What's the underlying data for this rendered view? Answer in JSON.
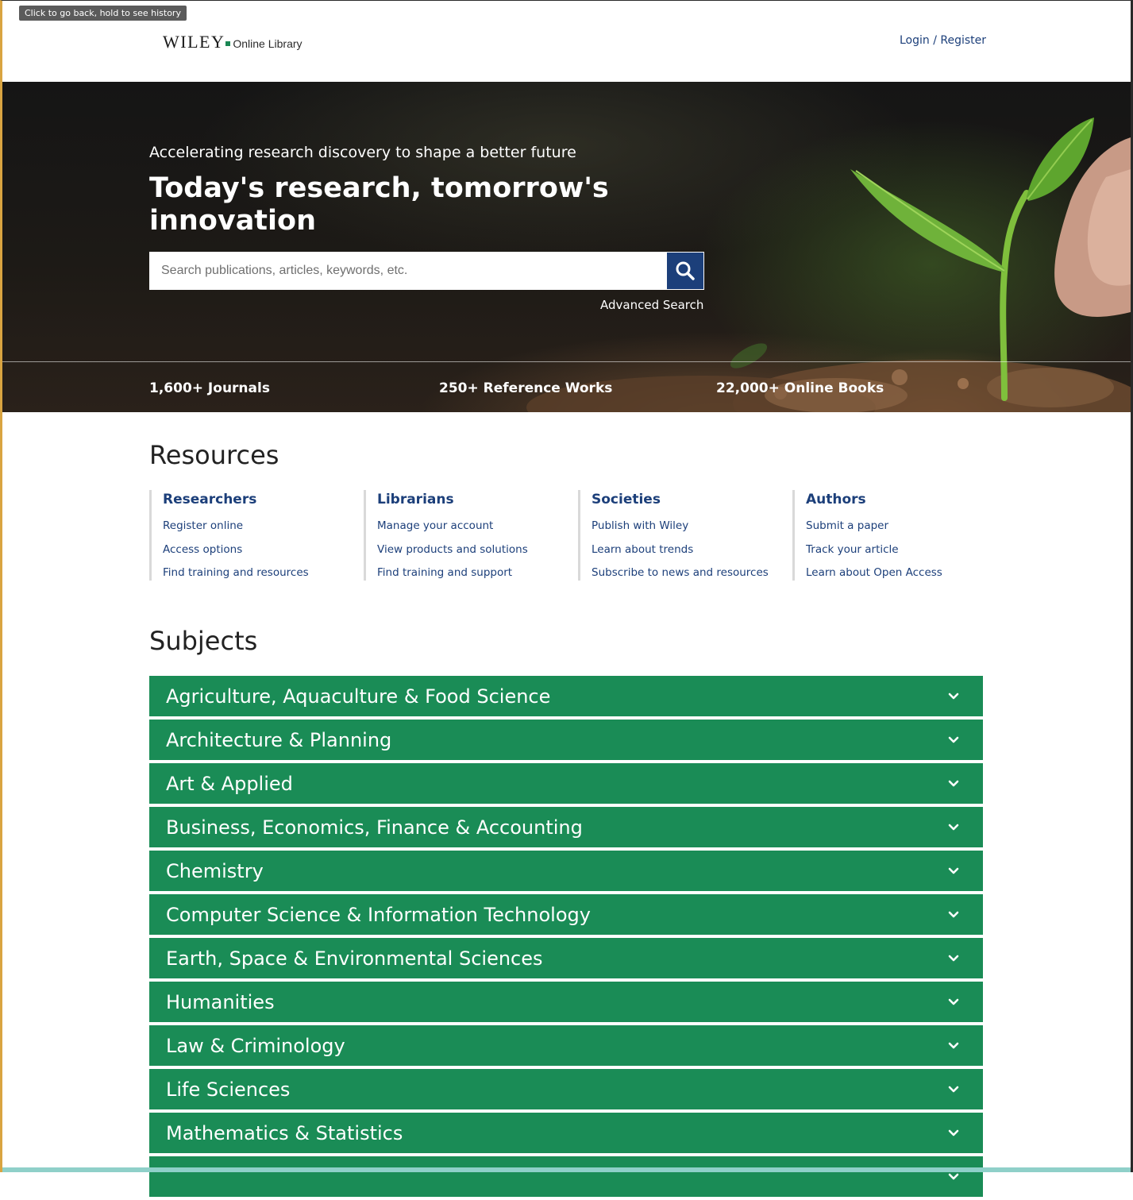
{
  "tooltip": "Click to go back, hold to see history",
  "header": {
    "logo_wiley": "WILEY",
    "logo_online_library": "Online Library",
    "login_register": "Login / Register"
  },
  "hero": {
    "tagline": "Accelerating research discovery to shape a better future",
    "title": "Today's research, tomorrow's innovation",
    "search_placeholder": "Search publications, articles, keywords, etc.",
    "search_value": "",
    "search_icon": "search-icon",
    "advanced_search": "Advanced Search",
    "stats": [
      "1,600+ Journals",
      "250+ Reference Works",
      "22,000+ Online Books"
    ]
  },
  "resources": {
    "title": "Resources",
    "columns": [
      {
        "heading": "Researchers",
        "links": [
          "Register online",
          "Access options",
          "Find training and resources"
        ]
      },
      {
        "heading": "Librarians",
        "links": [
          "Manage your account",
          "View products and solutions",
          "Find training and support"
        ]
      },
      {
        "heading": "Societies",
        "links": [
          "Publish with Wiley",
          "Learn about trends",
          "Subscribe to news and resources"
        ]
      },
      {
        "heading": "Authors",
        "links": [
          "Submit a paper",
          "Track your article",
          "Learn about Open Access"
        ]
      }
    ]
  },
  "subjects": {
    "title": "Subjects",
    "expand_icon": "chevron-down-icon",
    "items": [
      "Agriculture, Aquaculture & Food Science",
      "Architecture & Planning",
      "Art & Applied",
      "Business, Economics, Finance & Accounting",
      "Chemistry",
      "Computer Science & Information Technology",
      "Earth, Space & Environmental Sciences",
      "Humanities",
      "Law & Criminology",
      "Life Sciences",
      "Mathematics & Statistics",
      ""
    ]
  },
  "colors": {
    "navy": "#1c3f7a",
    "subject_green": "#1a8c56",
    "logo_green": "#1a8754"
  }
}
